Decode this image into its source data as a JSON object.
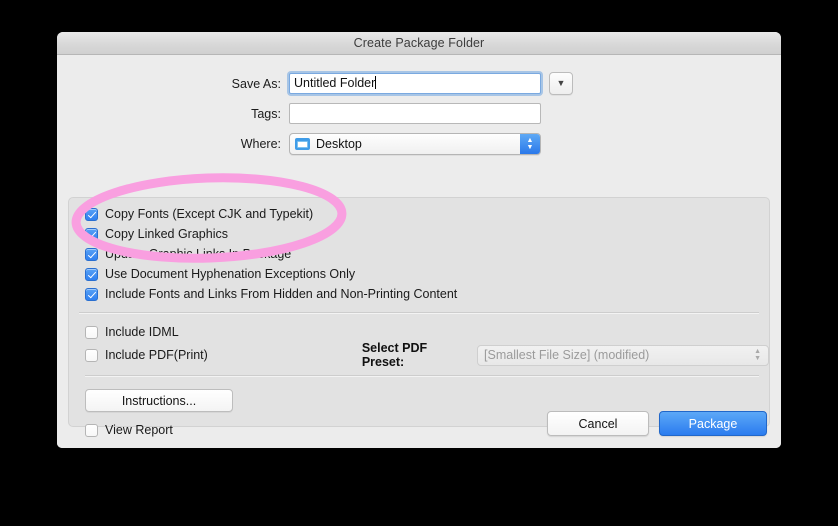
{
  "window": {
    "title": "Create Package Folder"
  },
  "form": {
    "save_as": {
      "label": "Save As:",
      "value": "Untitled Folder",
      "placeholder": "",
      "expand_icon": "chevron-down-icon"
    },
    "tags": {
      "label": "Tags:",
      "value": "",
      "placeholder": ""
    },
    "where": {
      "label": "Where:",
      "value": "Desktop",
      "icon": "folder-icon",
      "stepper_icon": "up-down-stepper-icon"
    }
  },
  "options": [
    {
      "label": "Copy Fonts (Except CJK and Typekit)",
      "checked": true
    },
    {
      "label": "Copy Linked Graphics",
      "checked": true
    },
    {
      "label": "Update Graphic Links In Package",
      "checked": true
    },
    {
      "label": "Use Document Hyphenation Exceptions Only",
      "checked": true
    },
    {
      "label": "Include Fonts and Links From Hidden and Non-Printing Content",
      "checked": true
    }
  ],
  "lower_options": [
    {
      "label": "Include IDML",
      "checked": false
    },
    {
      "label": "Include PDF(Print)",
      "checked": false
    }
  ],
  "pdf_preset": {
    "label": "Select PDF Preset:",
    "value": "[Smallest File Size] (modified)",
    "enabled": false,
    "stepper_icon": "up-down-stepper-icon"
  },
  "instructions_button": {
    "label": "Instructions..."
  },
  "view_report": {
    "label": "View Report",
    "checked": false
  },
  "buttons": {
    "cancel": "Cancel",
    "package": "Package"
  },
  "annotation": {
    "type": "ellipse-highlight",
    "color": "#f99fe0"
  },
  "colors": {
    "accent": "#2f7ff0",
    "default_button": "#2b7cef",
    "annotation_pink": "#f99fe0",
    "window_bg": "#ececec",
    "panel_bg": "#e2e2e2",
    "backdrop": "#000000"
  }
}
